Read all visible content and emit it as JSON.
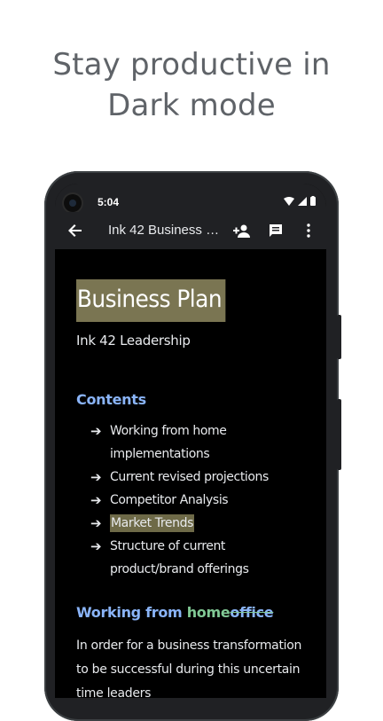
{
  "headline": {
    "line1": "Stay productive in",
    "line2": "Dark mode"
  },
  "status_bar": {
    "time": "5:04"
  },
  "toolbar": {
    "doc_title": "Ink 42 Business P..."
  },
  "document": {
    "title": "Business Plan",
    "subtitle": "Ink 42 Leadership",
    "contents_heading": "Contents",
    "toc_items": [
      "Working from home implementations",
      "Current revised projections",
      "Competitor Analysis",
      "Market Trends",
      "Structure of current product/brand offerings"
    ],
    "arrow": "➔",
    "section_heading": {
      "part1": "Working from ",
      "part2": "home",
      "part3": "office"
    },
    "paragraph": "In order for a business transformation to be successful during this uncertain time leaders"
  },
  "colors": {
    "headline": "#5f6368",
    "toolbar_bg": "#202124",
    "title_highlight": "#7a7552",
    "link_blue": "#8ab4f8",
    "suggest_green": "#81c995"
  },
  "icons": [
    "back-arrow-icon",
    "add-person-icon",
    "comment-icon",
    "more-vert-icon",
    "wifi-icon",
    "signal-icon",
    "battery-icon"
  ]
}
